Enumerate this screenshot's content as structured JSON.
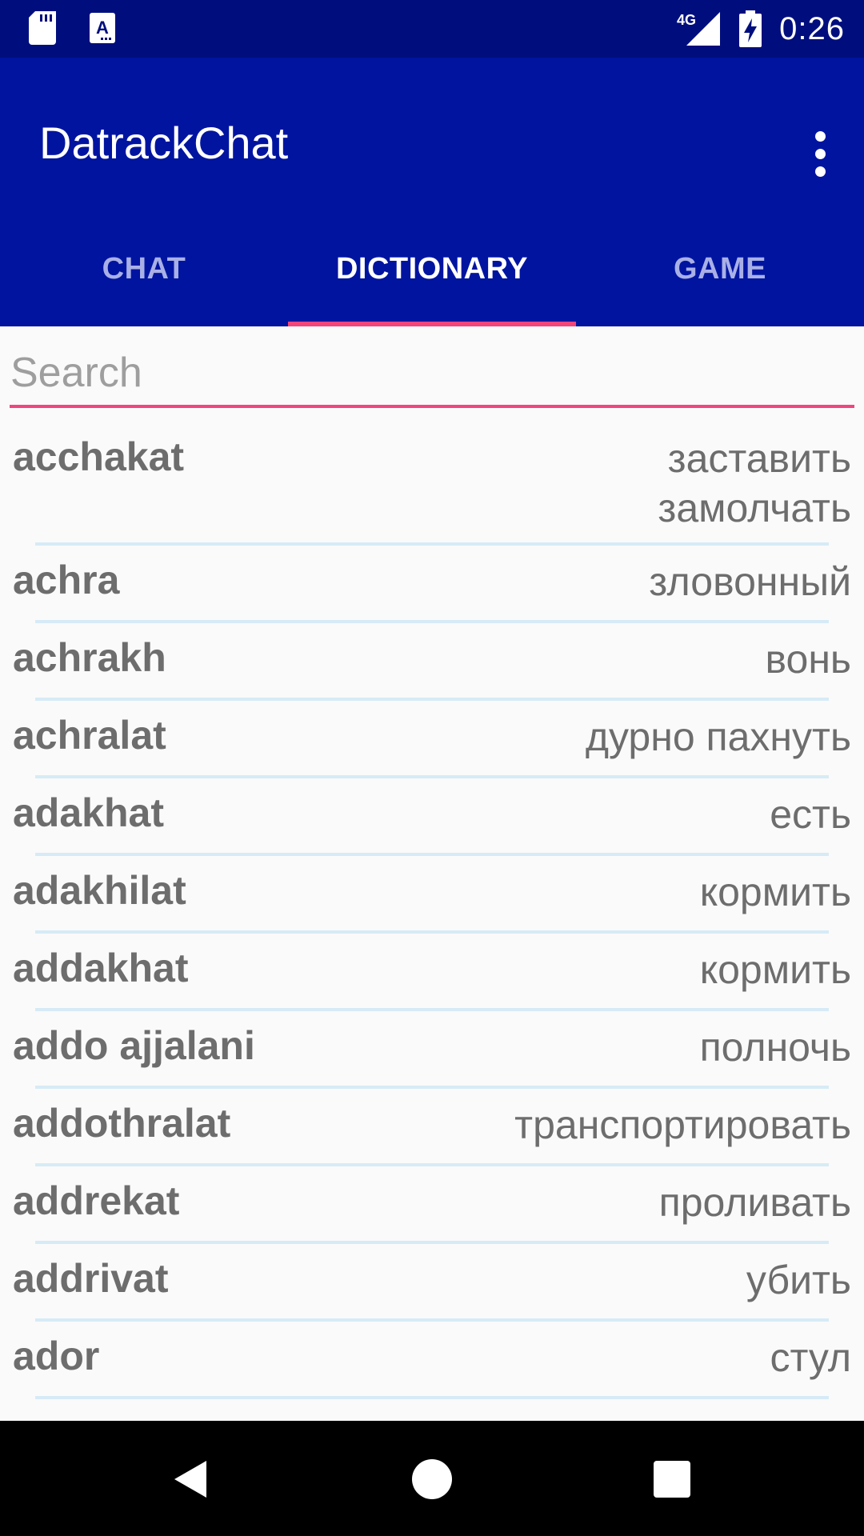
{
  "status_bar": {
    "time": "0:26",
    "network": "4G",
    "icons": [
      "sd-card-icon",
      "keyboard-a-icon",
      "signal-icon",
      "battery-charging-icon"
    ]
  },
  "app_bar": {
    "title": "DatrackChat",
    "menu_icon": "more-vert-icon"
  },
  "tabs": [
    {
      "label": "CHAT",
      "active": false
    },
    {
      "label": "DICTIONARY",
      "active": true
    },
    {
      "label": "GAME",
      "active": false
    }
  ],
  "search": {
    "placeholder": "Search",
    "value": ""
  },
  "entries": [
    {
      "term": "acchakat",
      "translation": "заставить замолчать"
    },
    {
      "term": "achra",
      "translation": "зловонный"
    },
    {
      "term": "achrakh",
      "translation": "вонь"
    },
    {
      "term": "achralat",
      "translation": "дурно пахнуть"
    },
    {
      "term": "adakhat",
      "translation": "есть"
    },
    {
      "term": "adakhilat",
      "translation": "кормить"
    },
    {
      "term": "addakhat",
      "translation": "кормить"
    },
    {
      "term": "addo ajjalani",
      "translation": "полночь"
    },
    {
      "term": "addothralat",
      "translation": "транспортировать"
    },
    {
      "term": "addrekat",
      "translation": "проливать"
    },
    {
      "term": "addrivat",
      "translation": "убить"
    },
    {
      "term": "ador",
      "translation": "стул"
    }
  ],
  "colors": {
    "status_bar": "#000e7d",
    "app_bar": "#0014a0",
    "accent": "#f2457c",
    "divider": "#d6ebf6"
  },
  "nav_bar": {
    "icons": [
      "back-icon",
      "home-icon",
      "recents-icon"
    ]
  }
}
